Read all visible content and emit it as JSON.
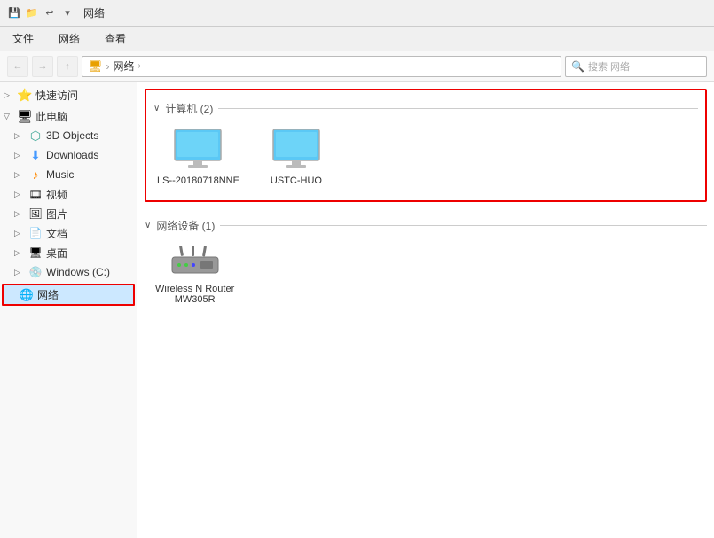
{
  "titlebar": {
    "title": "网络",
    "icons": [
      "save-icon",
      "folder-icon",
      "undo-icon"
    ]
  },
  "ribbon": {
    "tabs": [
      "文件",
      "网络",
      "查看"
    ]
  },
  "toolbar": {
    "back_disabled": true,
    "forward_disabled": true,
    "up_label": "↑",
    "address": [
      "网络"
    ],
    "address_label": "网络",
    "search_placeholder": "搜索 网络"
  },
  "sidebar": {
    "quick_access": {
      "label": "快速访问",
      "expanded": true
    },
    "this_pc": {
      "label": "此电脑",
      "expanded": true,
      "children": [
        {
          "label": "3D Objects",
          "icon": "3d"
        },
        {
          "label": "Downloads",
          "icon": "download"
        },
        {
          "label": "Music",
          "icon": "music"
        },
        {
          "label": "视频",
          "icon": "video"
        },
        {
          "label": "图片",
          "icon": "pictures"
        },
        {
          "label": "文档",
          "icon": "documents"
        },
        {
          "label": "桌面",
          "icon": "desktop"
        },
        {
          "label": "Windows (C:)",
          "icon": "drive"
        }
      ]
    },
    "network": {
      "label": "网络",
      "icon": "network",
      "active": true
    }
  },
  "content": {
    "computers_section": {
      "header": "计算机 (2)",
      "items": [
        {
          "name": "LS--20180718NNE",
          "type": "computer"
        },
        {
          "name": "USTC-HUO",
          "type": "computer"
        }
      ]
    },
    "network_devices_section": {
      "header": "网络设备 (1)",
      "items": [
        {
          "name": "Wireless N Router\nMW305R",
          "name_line1": "Wireless N Router",
          "name_line2": "MW305R",
          "type": "router"
        }
      ]
    }
  }
}
